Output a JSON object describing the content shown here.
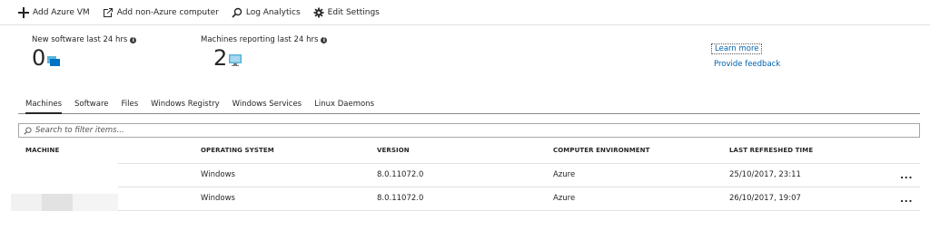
{
  "toolbar": {
    "add_azure_vm": "Add Azure VM",
    "add_non_azure": "Add non-Azure computer",
    "log_analytics": "Log Analytics",
    "edit_settings": "Edit Settings"
  },
  "stats": {
    "new_software": {
      "label": "New software last 24 hrs",
      "value": "0"
    },
    "machines_reporting": {
      "label": "Machines reporting last 24 hrs",
      "value": "2"
    }
  },
  "links": {
    "learn_more": "Learn more",
    "provide_feedback": "Provide feedback"
  },
  "tabs": [
    {
      "label": "Machines",
      "active": true
    },
    {
      "label": "Software",
      "active": false
    },
    {
      "label": "Files",
      "active": false
    },
    {
      "label": "Windows Registry",
      "active": false
    },
    {
      "label": "Windows Services",
      "active": false
    },
    {
      "label": "Linux Daemons",
      "active": false
    }
  ],
  "search": {
    "placeholder": "Search to filter items..."
  },
  "table": {
    "columns": [
      "MACHINE",
      "OPERATING SYSTEM",
      "VERSION",
      "COMPUTER ENVIRONMENT",
      "LAST REFRESHED TIME"
    ],
    "rows": [
      {
        "machine": "",
        "os": "Windows",
        "version": "8.0.11072.0",
        "environment": "Azure",
        "refreshed": "25/10/2017, 23:11",
        "more": "..."
      },
      {
        "machine": "",
        "os": "Windows",
        "version": "8.0.11072.0",
        "environment": "Azure",
        "refreshed": "26/10/2017, 19:07",
        "more": "..."
      }
    ]
  },
  "colors": {
    "link": "#0062ad",
    "icon_blue": "#0072c6"
  }
}
